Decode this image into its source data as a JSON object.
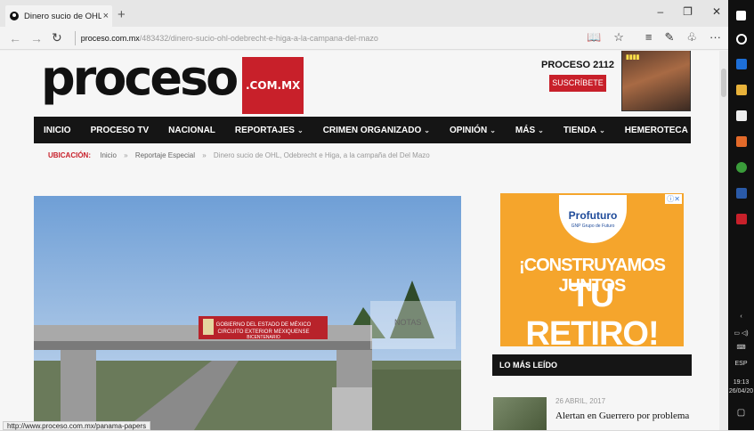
{
  "browser": {
    "tab_title": "Dinero sucio de OHL, O",
    "tab_close": "×",
    "new_tab": "+",
    "url_host": "proceso.com.mx",
    "url_path": "/483432/dinero-sucio-ohl-odebrecht-e-higa-a-la-campana-del-mazo",
    "status_url": "http://www.proceso.com.mx/panama-papers"
  },
  "site": {
    "logo_text": "proceso",
    "logo_tld": ".COM.MX",
    "edition": "PROCESO 2112",
    "subscribe": "SUSCRÍBETE"
  },
  "menu": [
    {
      "label": "INICIO",
      "chev": ""
    },
    {
      "label": "PROCESO TV",
      "chev": ""
    },
    {
      "label": "NACIONAL",
      "chev": ""
    },
    {
      "label": "REPORTAJES",
      "chev": "⌄"
    },
    {
      "label": "CRIMEN ORGANIZADO",
      "chev": "⌄"
    },
    {
      "label": "OPINIÓN",
      "chev": "⌄"
    },
    {
      "label": "MÁS",
      "chev": "⌄"
    },
    {
      "label": "TIENDA",
      "chev": "⌄"
    },
    {
      "label": "HEMEROTECA",
      "chev": ""
    }
  ],
  "breadcrumb": {
    "label": "UBICACIÓN:",
    "items": [
      "Inicio",
      "Reportaje Especial",
      "Dinero sucio de OHL, Odebrecht e Higa, a la campaña del Del Mazo"
    ],
    "arrow": "»"
  },
  "hero": {
    "sign_line1": "GOBIERNO DEL ESTADO DE MÉXICO",
    "sign_line2": "CIRCUITO EXTERIOR MEXIQUENSE",
    "sign_line3": "BICENTENARIO",
    "overlay": "NOTAS"
  },
  "ad": {
    "brand": "Profuturo",
    "brand_sub": "GNP Grupo de Futuro",
    "line1": "¡CONSTRUYAMOS JUNTOS",
    "line2": "TU RETIRO!"
  },
  "sidebar": {
    "most_read": "LO MÁS LEÍDO",
    "item_date": "26 ABRIL, 2017",
    "item_title": "Alertan en Guerrero por problema"
  },
  "taskbar": {
    "lang": "ESP",
    "time": "19:13",
    "date": "26/04/20"
  },
  "colors": {
    "brand_red": "#c8202a",
    "menu_bg": "#151515",
    "ad_orange": "#f5a52c"
  }
}
